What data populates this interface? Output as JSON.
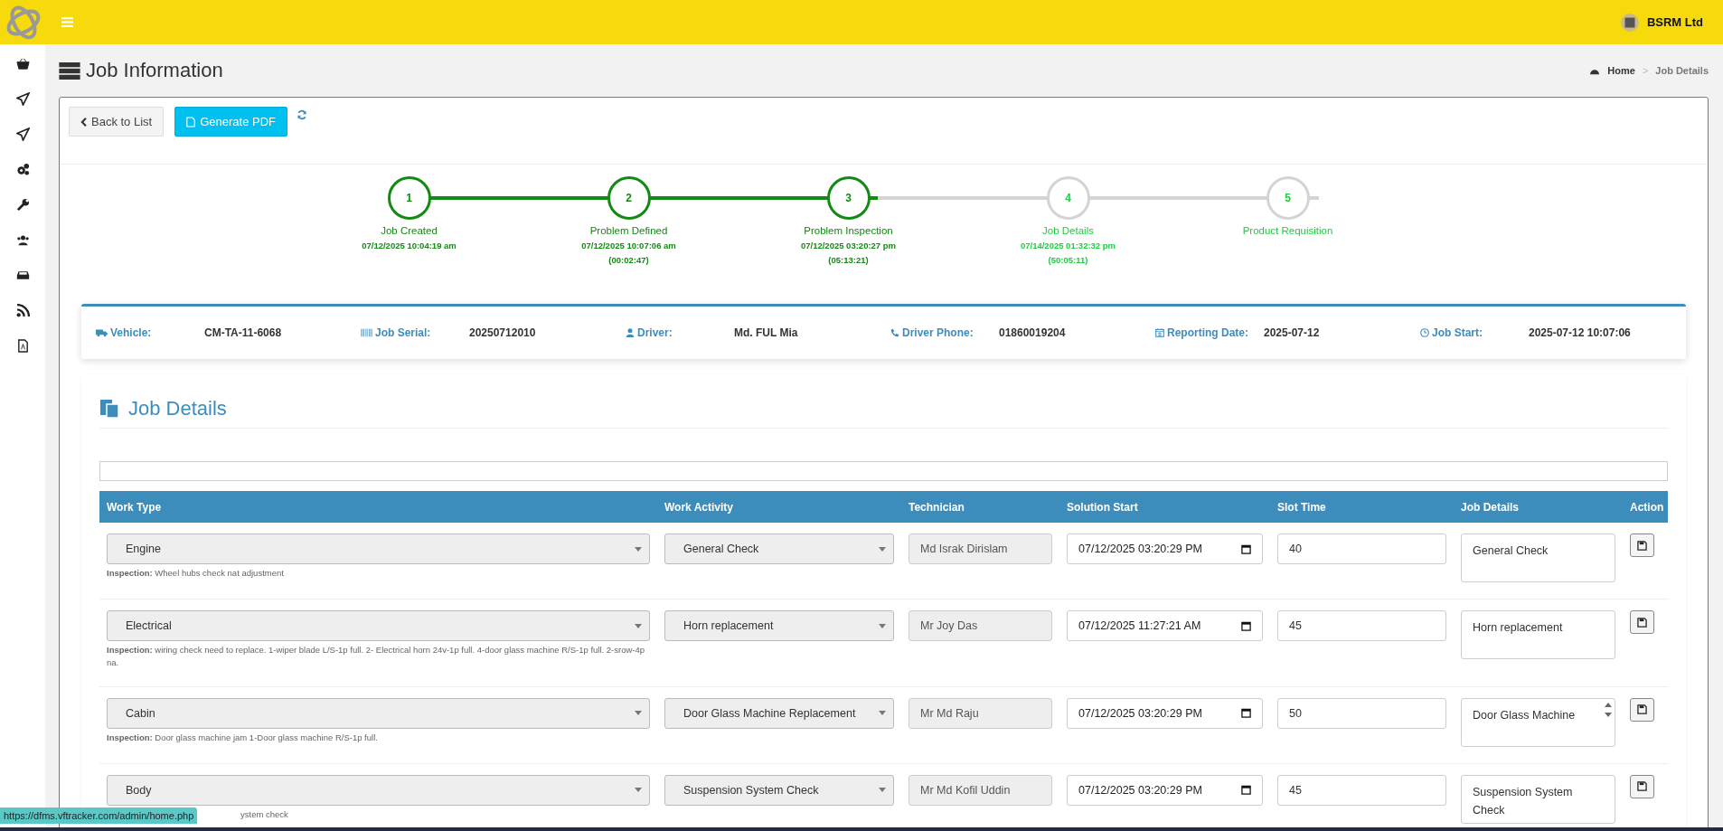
{
  "header": {
    "company": "BSRM Ltd"
  },
  "page": {
    "title": "Job Information",
    "breadcrumb": [
      {
        "label": "Home",
        "current": false
      },
      {
        "label": "Job Details",
        "current": true
      }
    ],
    "separator": ">"
  },
  "toolbar": {
    "back": "Back to List",
    "pdf": "Generate PDF"
  },
  "steps": [
    {
      "number": "1",
      "label": "Job Created",
      "time": "07/12/2025 10:04:19 am",
      "done": true
    },
    {
      "number": "2",
      "label": "Problem Defined",
      "time": "07/12/2025 10:07:06 am",
      "duration": "(00:02:47)",
      "done": true
    },
    {
      "number": "3",
      "label": "Problem Inspection",
      "time": "07/12/2025 03:20:27 pm",
      "duration": "(05:13:21)",
      "done": true
    },
    {
      "number": "4",
      "label": "Job Details",
      "time": "07/14/2025 01:32:32 pm",
      "duration": "(50:05:11)",
      "done": false
    },
    {
      "number": "5",
      "label": "Product Requisition",
      "done": false
    }
  ],
  "info": [
    {
      "kind": "truck",
      "label": "Vehicle:",
      "value": "CM-TA-11-6068"
    },
    {
      "kind": "barcode",
      "label": "Job Serial:",
      "value": "20250712010"
    },
    {
      "kind": "user",
      "label": "Driver:",
      "value": "Md. FUL Mia"
    },
    {
      "kind": "phone",
      "label": "Driver Phone:",
      "value": "01860019204"
    },
    {
      "kind": "calendar",
      "label": "Reporting Date:",
      "value": "2025-07-12"
    },
    {
      "kind": "clock",
      "label": "Job Start:",
      "value": "2025-07-12 10:07:06"
    }
  ],
  "job_details": {
    "title": "Job Details",
    "columns": [
      "Work Type",
      "Work Activity",
      "Technician",
      "Solution Start",
      "Slot Time",
      "Job Details",
      "Action"
    ],
    "rows": [
      {
        "work_type": "Engine",
        "work_activity": "General Check",
        "technician": "Md Israk Dirislam",
        "solution_start": "07/12/2025 03:20:29 PM",
        "slot_time": "40",
        "job_details": "General Check",
        "inspection": "**Inspection:** Wheel hubs check nat adjustment"
      },
      {
        "work_type": "Electrical",
        "work_activity": "Horn replacement",
        "technician": "Mr Joy Das",
        "solution_start": "07/12/2025 11:27:21 AM",
        "slot_time": "45",
        "job_details": "Horn replacement",
        "inspection": "**Inspection:** wiring check need to replace. 1-wiper blade L/S-1p full. 2- Electrical horn 24v-1p full. 4-door glass machine R/S-1p full. 2-srow-4p na."
      },
      {
        "work_type": "Cabin",
        "work_activity": "Door Glass Machine Replacement",
        "technician": "Mr Md Raju",
        "solution_start": "07/12/2025 03:20:29 PM",
        "slot_time": "50",
        "job_details": "Door Glass Machine",
        "scroll": true,
        "inspection": "**Inspection:** Door glass machine jam 1-Door glass machine R/S-1p full."
      },
      {
        "work_type": "Body",
        "work_activity": "Suspension System Check",
        "technician": "Mr Md Kofil Uddin",
        "solution_start": "07/12/2025 03:20:29 PM",
        "slot_time": "45",
        "job_details": "Suspension System Check",
        "inspection_cut": "ystem check"
      }
    ]
  },
  "status_bar": {
    "url": "https://dfms.vftracker.com/admin/home.php"
  }
}
